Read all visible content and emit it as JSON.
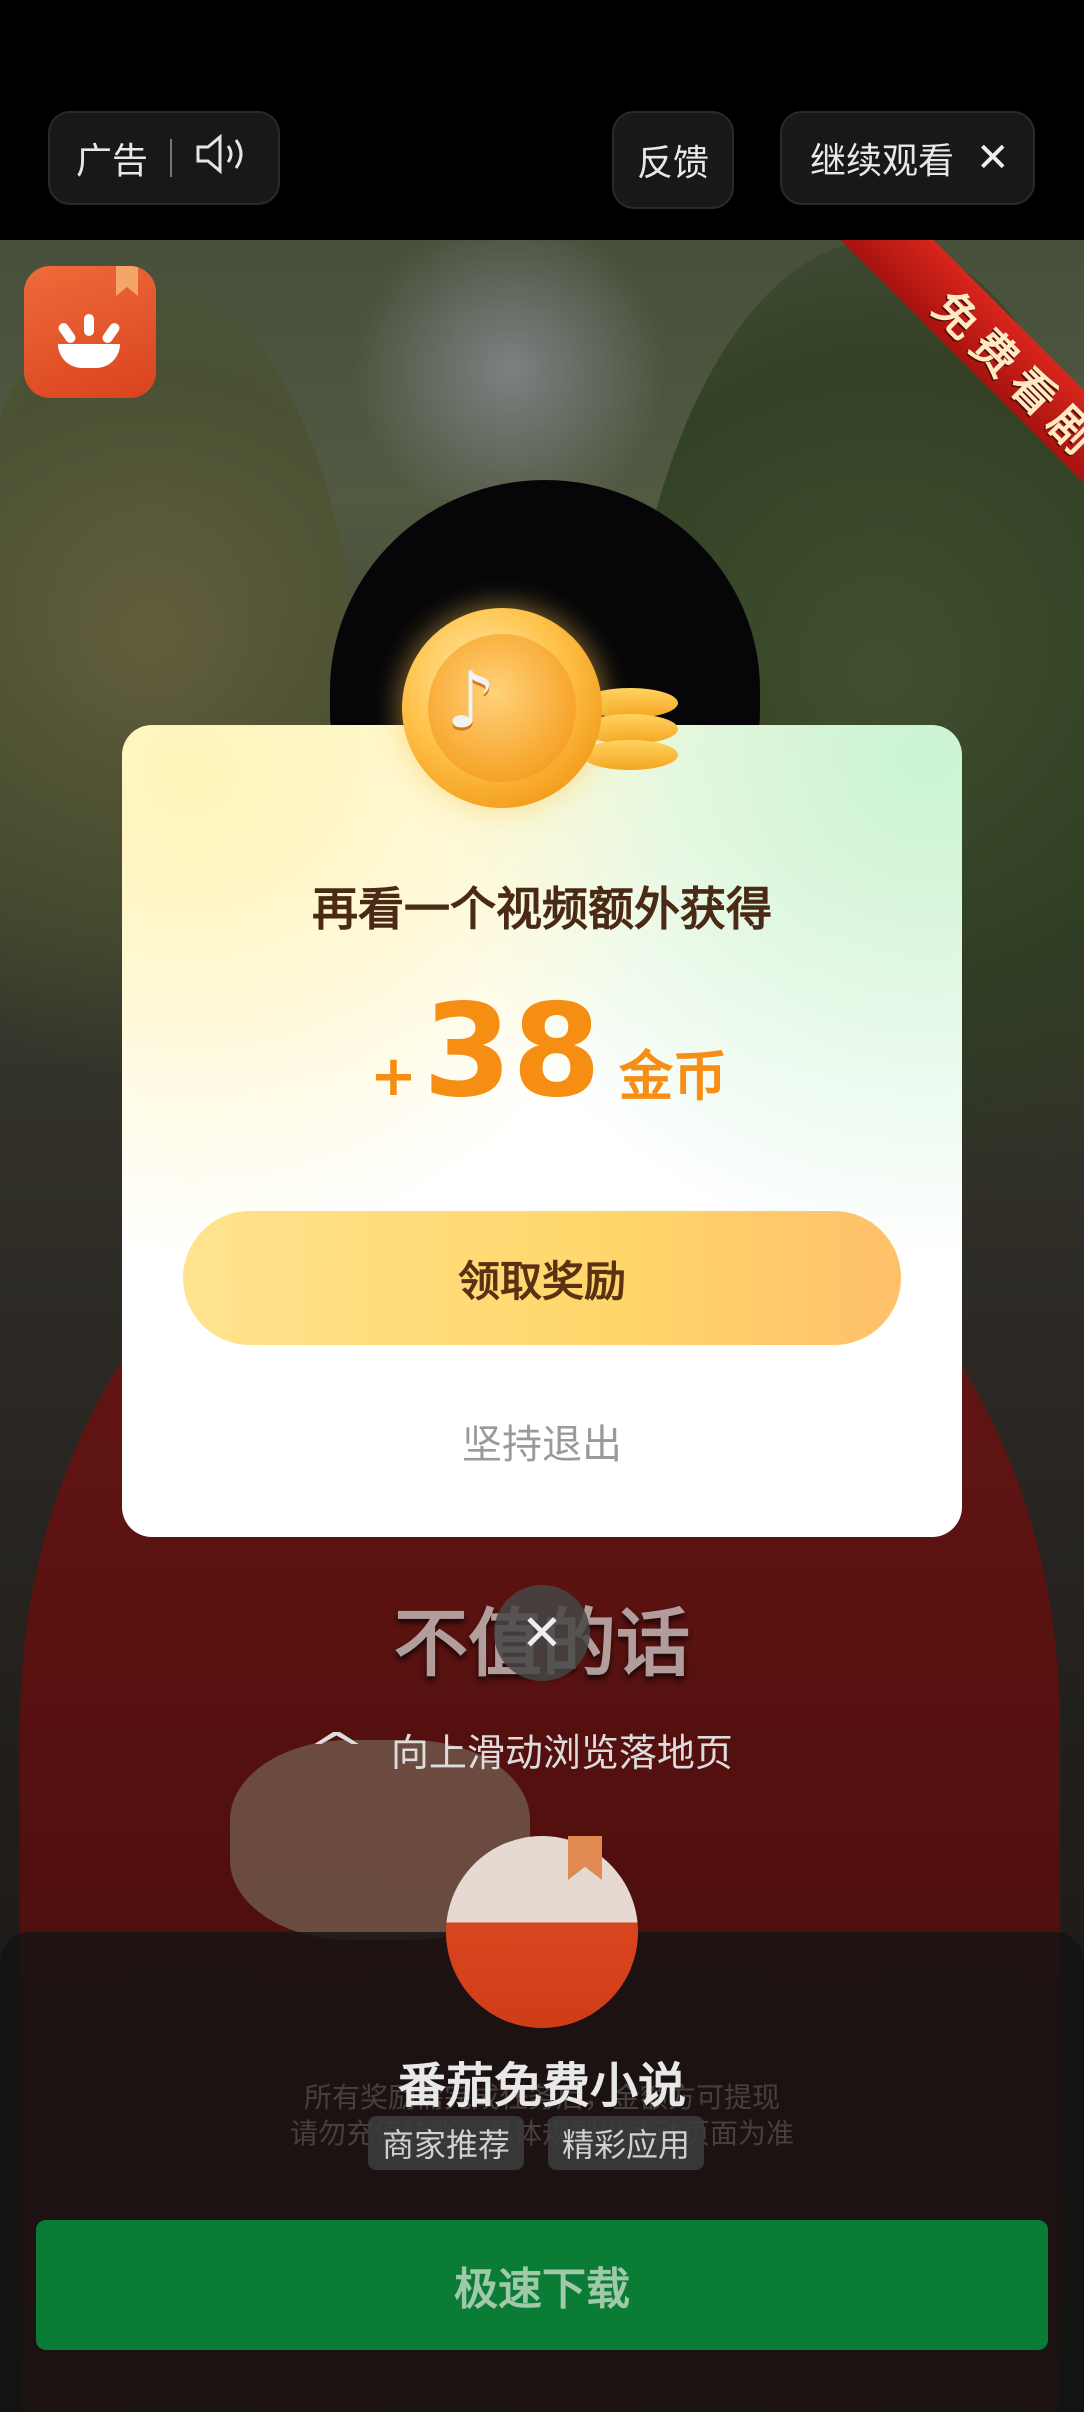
{
  "top_bar": {
    "ad_label": "广告",
    "sound_icon": "speaker-icon",
    "feedback_label": "反馈",
    "continue_label": "继续观看",
    "close_icon": "close-icon"
  },
  "ribbon_text": "免费看剧",
  "video_caption": "不值的话",
  "swipe_hint": "向上滑动浏览落地页",
  "modal": {
    "title": "再看一个视频额外获得",
    "plus": "+",
    "amount": "38",
    "unit": "金币",
    "claim_button": "领取奖励",
    "quit_link": "坚持退出"
  },
  "bottom_panel": {
    "app_name": "番茄免费小说",
    "faint_line_1": "所有奖励需完成任务后，金额方可提现",
    "faint_line_2": "请勿充值转账，具体规则以活动页面为准",
    "tags": [
      "商家推荐",
      "精彩应用"
    ],
    "download_button": "极速下载"
  },
  "colors": {
    "accent_orange": "#f58e12",
    "download_green": "#0b7c36",
    "claim_yellow": "#ffd66a"
  }
}
